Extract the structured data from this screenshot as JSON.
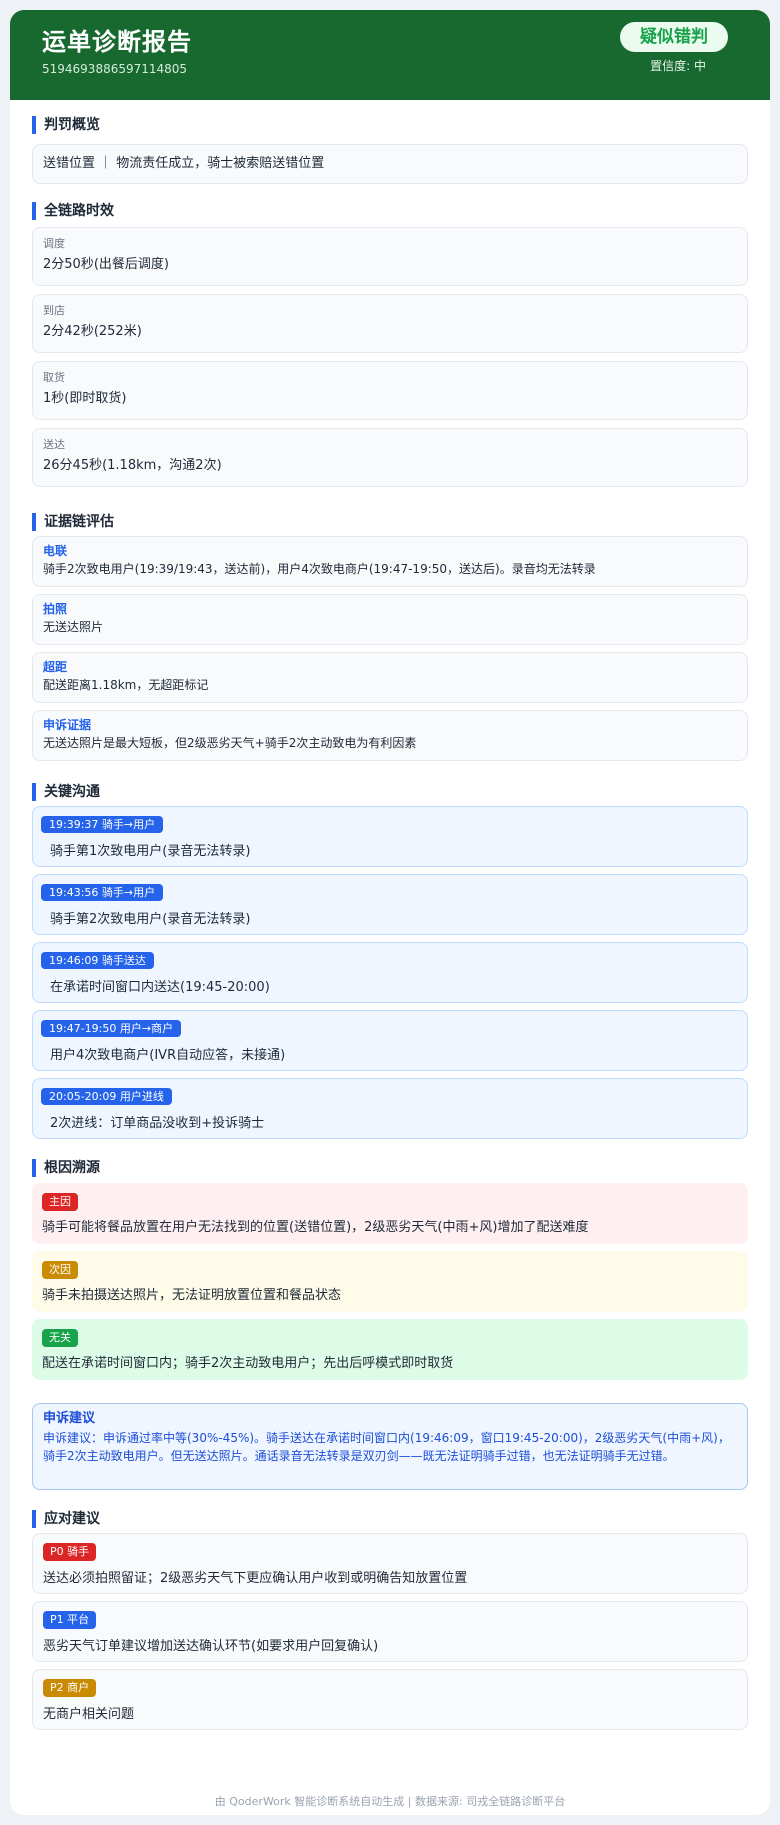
{
  "header": {
    "title": "运单诊断报告",
    "order_id": "5194693886597114805",
    "verdict": "疑似错判",
    "confidence_label": "置信度:",
    "confidence_value": "中"
  },
  "colors": {
    "header_bg": "#17692f",
    "accent_blue": "#2563eb",
    "primary_cause": "#dc2626",
    "secondary_cause": "#ca8a04",
    "unrelated_cause": "#16a34a"
  },
  "summary": {
    "title": "判罚概览",
    "text": "送错位置 ｜ 物流责任成立，骑士被索赔送错位置"
  },
  "timing": {
    "title": "全链路时效",
    "items": [
      {
        "label": "调度",
        "value": "2分50秒(出餐后调度)"
      },
      {
        "label": "到店",
        "value": "2分42秒(252米)"
      },
      {
        "label": "取货",
        "value": "1秒(即时取货)"
      },
      {
        "label": "送达",
        "value": "26分45秒(1.18km，沟通2次)"
      }
    ]
  },
  "evidence": {
    "title": "证据链评估",
    "items": [
      {
        "label": "电联",
        "text": "骑手2次致电用户(19:39/19:43，送达前)，用户4次致电商户(19:47-19:50，送达后)。录音均无法转录"
      },
      {
        "label": "拍照",
        "text": "无送达照片"
      },
      {
        "label": "超距",
        "text": "配送距离1.18km，无超距标记"
      },
      {
        "label": "申诉证据",
        "text": "无送达照片是最大短板，但2级恶劣天气+骑手2次主动致电为有利因素"
      }
    ]
  },
  "communication": {
    "title": "关键沟通",
    "items": [
      {
        "tag": "19:39:37  骑手→用户",
        "text": "骑手第1次致电用户(录音无法转录)"
      },
      {
        "tag": "19:43:56  骑手→用户",
        "text": "骑手第2次致电用户(录音无法转录)"
      },
      {
        "tag": "19:46:09  骑手送达",
        "text": "在承诺时间窗口内送达(19:45-20:00)"
      },
      {
        "tag": "19:47-19:50  用户→商户",
        "text": "用户4次致电商户(IVR自动应答，未接通)"
      },
      {
        "tag": "20:05-20:09  用户进线",
        "text": "2次进线：订单商品没收到+投诉骑士"
      }
    ]
  },
  "root_cause": {
    "title": "根因溯源",
    "items": [
      {
        "tag": "主因",
        "text": "骑手可能将餐品放置在用户无法找到的位置(送错位置)，2级恶劣天气(中雨+风)增加了配送难度"
      },
      {
        "tag": "次因",
        "text": "骑手未拍摄送达照片，无法证明放置位置和餐品状态"
      },
      {
        "tag": "无关",
        "text": "配送在承诺时间窗口内；骑手2次主动致电用户；先出后呼模式即时取货"
      }
    ]
  },
  "appeal": {
    "title": "申诉建议",
    "text": "申诉建议：申诉通过率中等(30%-45%)。骑手送达在承诺时间窗口内(19:46:09，窗口19:45-20:00)，2级恶劣天气(中雨+风)，骑手2次主动致电用户。但无送达照片。通话录音无法转录是双刃剑——既无法证明骑手过错，也无法证明骑手无过错。"
  },
  "suggestions": {
    "title": "应对建议",
    "items": [
      {
        "tag": "P0 骑手",
        "text": "送达必须拍照留证；2级恶劣天气下更应确认用户收到或明确告知放置位置"
      },
      {
        "tag": "P1 平台",
        "text": "恶劣天气订单建议增加送达确认环节(如要求用户回复确认)"
      },
      {
        "tag": "P2 商户",
        "text": "无商户相关问题"
      }
    ]
  },
  "footer": {
    "text": "由 QoderWork 智能诊断系统自动生成 | 数据来源: 司戎全链路诊断平台"
  }
}
